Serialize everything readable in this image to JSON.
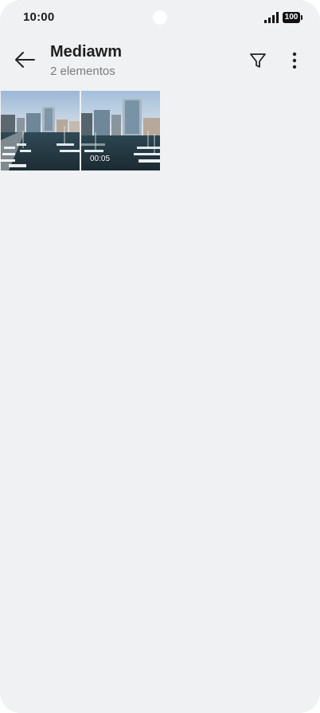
{
  "status_bar": {
    "time": "10:00",
    "battery_level": "100",
    "signal_icon": "cellular-signal-icon",
    "battery_icon": "battery-icon"
  },
  "app_bar": {
    "back_icon": "arrow-back-icon",
    "title": "Mediawm",
    "subtitle": "2 elementos",
    "filter_icon": "filter-icon",
    "more_icon": "more-vertical-icon"
  },
  "media": {
    "items": [
      {
        "type": "image",
        "thumbnail_icon": "marina-photo"
      },
      {
        "type": "video",
        "duration": "00:05",
        "thumbnail_icon": "marina-video"
      }
    ]
  },
  "colors": {
    "background": "#f0f1f3",
    "text_primary": "#1f1f1f",
    "text_secondary": "#7b7b7b"
  }
}
